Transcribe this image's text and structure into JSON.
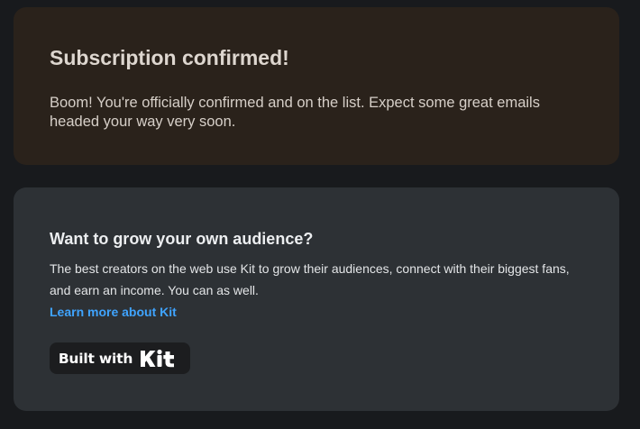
{
  "confirmation": {
    "title": "Subscription confirmed!",
    "body": "Boom! You're officially confirmed and on the list. Expect some great emails headed your way very soon."
  },
  "promo": {
    "title": "Want to grow your own audience?",
    "body": "The best creators on the web use Kit to grow their audiences, connect with their biggest fans, and earn an income. You can as well.",
    "link_label": "Learn more about Kit",
    "badge": {
      "text": "Built with",
      "logo_text": "Kit",
      "logo_icon": "kit-logo-icon"
    }
  },
  "colors": {
    "page_background": "#181a1d",
    "confirm_card_background": "#2a221b",
    "promo_card_background": "#2d3135",
    "link": "#3fa4ff",
    "badge_background": "#1c1d1f"
  }
}
